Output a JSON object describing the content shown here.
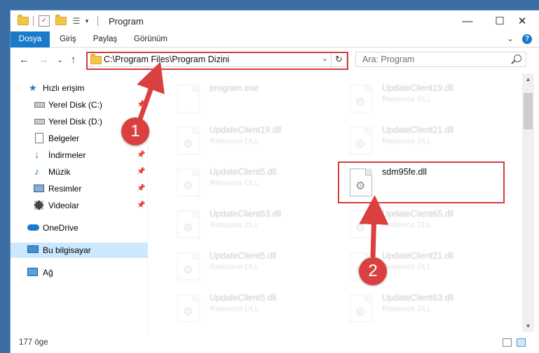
{
  "window": {
    "title": "Program",
    "controls": {
      "minimize": "—",
      "maximize": "☐",
      "close": "✕"
    }
  },
  "ribbon": {
    "tabs": [
      "Dosya",
      "Giriş",
      "Paylaş",
      "Görünüm"
    ],
    "help": "?",
    "collapse": "⌄"
  },
  "navigation": {
    "back": "←",
    "forward": "→",
    "recent": "⌄",
    "up": "↑",
    "address": "C:\\Program Files\\Program Dizini",
    "address_dropdown": "⌄",
    "refresh": "↻",
    "search_placeholder": "Ara: Program"
  },
  "sidebar": {
    "items": [
      {
        "label": "Hızlı erişim",
        "icon": "star-icon",
        "pinned": false
      },
      {
        "label": "Yerel Disk (C:)",
        "icon": "drive-icon",
        "pinned": true
      },
      {
        "label": "Yerel Disk (D:)",
        "icon": "drive-icon",
        "pinned": false
      },
      {
        "label": "Belgeler",
        "icon": "documents-icon",
        "pinned": false
      },
      {
        "label": "İndirmeler",
        "icon": "download-icon",
        "pinned": true
      },
      {
        "label": "Müzik",
        "icon": "music-icon",
        "pinned": true
      },
      {
        "label": "Resimler",
        "icon": "pictures-icon",
        "pinned": true
      },
      {
        "label": "Videolar",
        "icon": "video-icon",
        "pinned": true
      },
      {
        "label": "OneDrive",
        "icon": "cloud-icon",
        "pinned": false
      },
      {
        "label": "Bu bilgisayar",
        "icon": "computer-icon",
        "pinned": false,
        "selected": true
      },
      {
        "label": "Ağ",
        "icon": "network-icon",
        "pinned": false
      }
    ]
  },
  "files": [
    {
      "name": "program.exe",
      "type": "",
      "faded": true
    },
    {
      "name": "UpdateClient19.dll",
      "type": "Resource DLL",
      "faded": true
    },
    {
      "name": "UpdateClient19.dll",
      "type": "Resource DLL",
      "faded": true
    },
    {
      "name": "UpdateClient21.dll",
      "type": "Resource DLL",
      "faded": true
    },
    {
      "name": "UpdateClient5.dll",
      "type": "Resource DLL",
      "faded": true
    },
    {
      "name": "sdm95fe.dll",
      "type": "",
      "faded": false
    },
    {
      "name": "UpdateClient63.dll",
      "type": "Resource DLL",
      "faded": true
    },
    {
      "name": "UpdateClient65.dll",
      "type": "Resource DLL",
      "faded": true
    },
    {
      "name": "UpdateClient5.dll",
      "type": "Resource DLL",
      "faded": true
    },
    {
      "name": "UpdateClient21.dll",
      "type": "Resource DLL",
      "faded": true
    },
    {
      "name": "UpdateClient5.dll",
      "type": "Resource DLL",
      "faded": true
    },
    {
      "name": "UpdateClient63.dll",
      "type": "Resource DLL",
      "faded": true
    }
  ],
  "status": {
    "item_count": "177 öge"
  },
  "callouts": {
    "first": "1",
    "second": "2"
  },
  "colors": {
    "highlight": "#d43c3c",
    "callout": "#d9403f",
    "accent": "#1979ca",
    "selected": "#cce8ff"
  }
}
